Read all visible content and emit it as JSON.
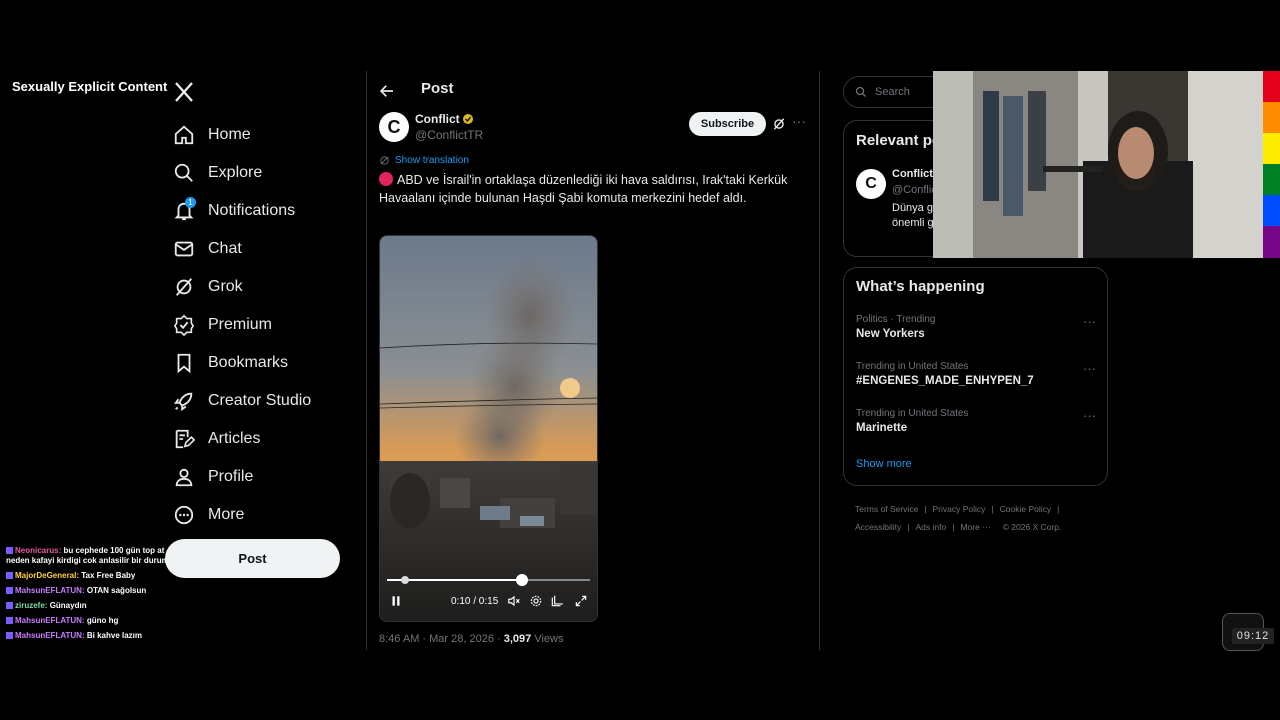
{
  "overlay": {
    "label": "Sexually Explicit Content"
  },
  "nav": {
    "items": [
      {
        "label": "Home",
        "icon": "home-icon"
      },
      {
        "label": "Explore",
        "icon": "search-icon"
      },
      {
        "label": "Notifications",
        "icon": "bell-icon",
        "badge": "1"
      },
      {
        "label": "Chat",
        "icon": "mail-icon"
      },
      {
        "label": "Grok",
        "icon": "grok-icon"
      },
      {
        "label": "Premium",
        "icon": "premium-icon"
      },
      {
        "label": "Bookmarks",
        "icon": "bookmark-icon"
      },
      {
        "label": "Creator Studio",
        "icon": "rocket-icon"
      },
      {
        "label": "Articles",
        "icon": "articles-icon"
      },
      {
        "label": "Profile",
        "icon": "person-icon"
      },
      {
        "label": "More",
        "icon": "more-circle-icon"
      }
    ],
    "post_button": "Post"
  },
  "chat": [
    {
      "user": "Neonicarus:",
      "text": "bu cephede 100 gün top at",
      "text2": "neden kafayi kirdigi cok anlasilir bir durum"
    },
    {
      "user": "MajorDeGeneral:",
      "text": "Tax Free Baby"
    },
    {
      "user": "MahsunEFLATUN:",
      "text": "OTAN sağolsun"
    },
    {
      "user": "ziruzefe:",
      "text": "Günaydın"
    },
    {
      "user": "MahsunEFLATUN:",
      "text": "güno hg"
    },
    {
      "user": "MahsunEFLATUN:",
      "text": "Bi kahve lazım"
    }
  ],
  "main": {
    "title": "Post",
    "author": {
      "name": "Conflict",
      "handle": "@ConflictTR",
      "avatar_letter": "C"
    },
    "subscribe": "Subscribe",
    "show_translation": "Show translation",
    "text": "ABD ve İsrail'in ortaklaşa düzenlediği iki hava saldırısı, Irak'taki Kerkük Havaalanı içinde bulunan Haşdi Şabi komuta merkezini hedef aldı.",
    "video": {
      "time": "0:10 / 0:15",
      "progress": 0.667,
      "buffered_marker": 0.09
    },
    "meta": {
      "time": "8:46 AM · Mar 28, 2026 · ",
      "views_count": "3,097",
      "views_label": " Views"
    }
  },
  "right": {
    "search_placeholder": "Search",
    "relevant": {
      "title": "Relevant people",
      "name": "Conflict",
      "handle": "@ConflictTR",
      "bio": "Dünya g... teknoloj... önemli g..."
    },
    "happening": {
      "title": "What’s happening",
      "trends": [
        {
          "context": "Politics · Trending",
          "name": "New Yorkers"
        },
        {
          "context": "Trending in United States",
          "name": "#ENGENES_MADE_ENHYPEN_7"
        },
        {
          "context": "Trending in United States",
          "name": "Marinette"
        }
      ],
      "show_more": "Show more"
    },
    "footer": {
      "links": [
        "Terms of Service",
        "Privacy Policy",
        "Cookie Policy",
        "Accessibility",
        "Ads info",
        "More ···",
        "© 2026 X Corp."
      ]
    }
  },
  "clock": "09:12",
  "colors": {
    "accent": "#1d9bf0",
    "background": "#000000",
    "border": "#2f3336",
    "muted": "#71767b"
  }
}
